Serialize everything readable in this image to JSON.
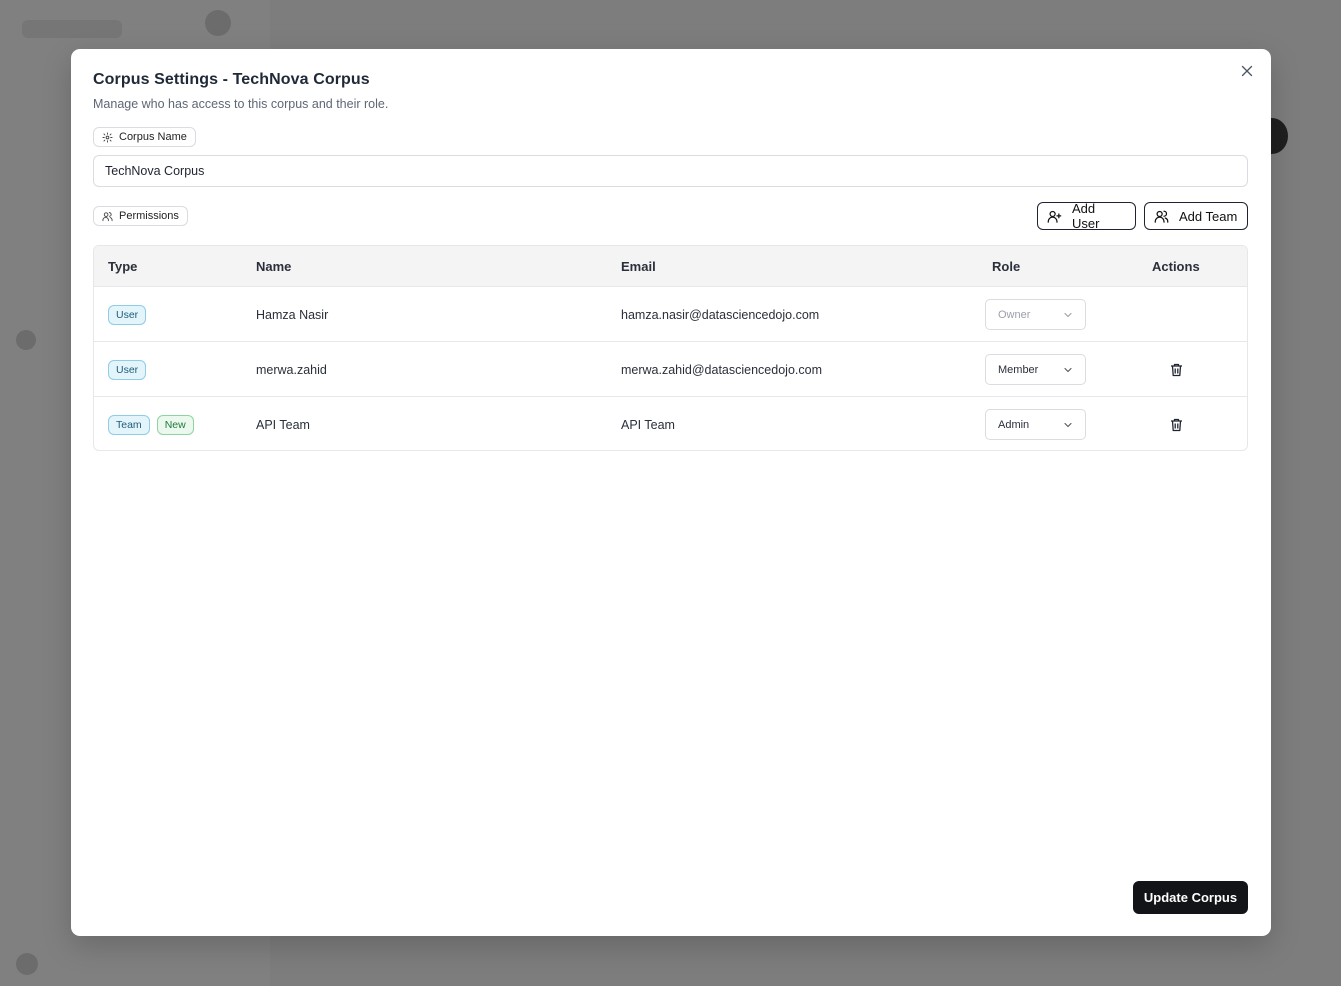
{
  "modal": {
    "title": "Corpus Settings - TechNova Corpus",
    "subtitle": "Manage who has access to this corpus and their role."
  },
  "sections": {
    "corpus_name_label": "Corpus Name",
    "permissions_label": "Permissions"
  },
  "corpus_name_input": {
    "value": "TechNova Corpus"
  },
  "buttons": {
    "add_user": "Add User",
    "add_team": "Add Team",
    "update": "Update Corpus"
  },
  "table": {
    "headers": {
      "type": "Type",
      "name": "Name",
      "email": "Email",
      "role": "Role",
      "actions": "Actions"
    },
    "rows": [
      {
        "type_badge": "User",
        "extra_badge": "",
        "name": "Hamza Nasir",
        "email": "hamza.nasir@datasciencedojo.com",
        "role": "Owner",
        "role_disabled": true,
        "deletable": false
      },
      {
        "type_badge": "User",
        "extra_badge": "",
        "name": "merwa.zahid",
        "email": "merwa.zahid@datasciencedojo.com",
        "role": "Member",
        "role_disabled": false,
        "deletable": true
      },
      {
        "type_badge": "Team",
        "extra_badge": "New",
        "name": "API Team",
        "email": "API Team",
        "role": "Admin",
        "role_disabled": false,
        "deletable": true
      }
    ]
  },
  "colors": {
    "primary": "#131418",
    "badge_blue_bg": "#e3f4fb",
    "badge_green_bg": "#eaf8ee",
    "backdrop": "#7d7d7d"
  }
}
